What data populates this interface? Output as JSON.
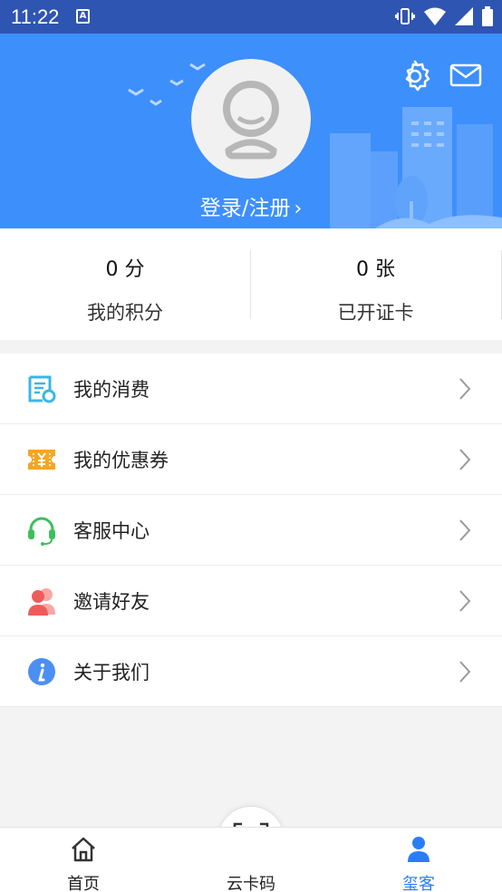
{
  "status_bar": {
    "time": "11:22",
    "app_badge": "A"
  },
  "header": {
    "login_label": "登录/注册",
    "login_chevron": "›"
  },
  "stats": [
    {
      "value": "0 分",
      "label": "我的积分"
    },
    {
      "value": "0 张",
      "label": "已开证卡"
    }
  ],
  "menu": [
    {
      "label": "我的消费",
      "icon": "receipt-icon",
      "color": "#3bb6e8"
    },
    {
      "label": "我的优惠券",
      "icon": "coupon-icon",
      "color": "#f5a623"
    },
    {
      "label": "客服中心",
      "icon": "headset-icon",
      "color": "#3dbf5a"
    },
    {
      "label": "邀请好友",
      "icon": "invite-friends-icon",
      "color": "#ef5b5b"
    },
    {
      "label": "关于我们",
      "icon": "info-icon",
      "color": "#4c8ff2"
    }
  ],
  "tabs": [
    {
      "label": "首页",
      "icon": "home-icon"
    },
    {
      "label": "云卡码",
      "icon": "barcode-scan-icon"
    },
    {
      "label": "玺客",
      "icon": "user-icon",
      "active": true
    }
  ],
  "colors": {
    "header": "#3d8ffb",
    "status_bar": "#2f55b2",
    "active_tab": "#2a7ef5"
  }
}
